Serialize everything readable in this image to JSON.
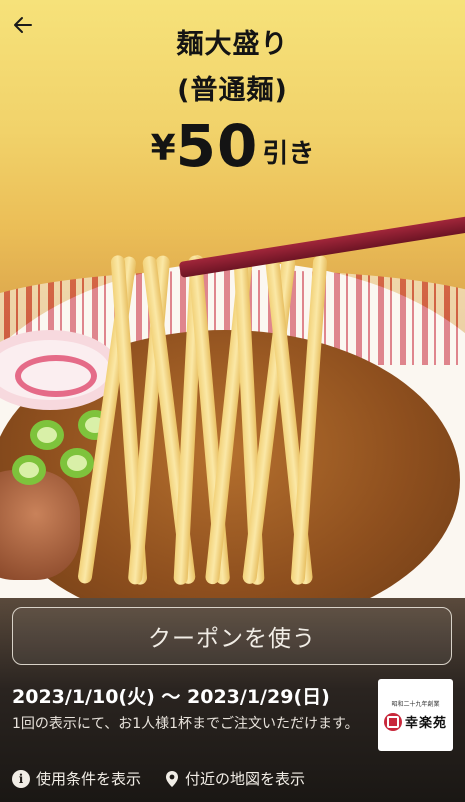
{
  "header": {
    "back_icon": "arrow-left-icon",
    "title_line1": "麺大盛り",
    "title_line2": "(普通麺)",
    "price_currency": "¥",
    "price_amount": "50",
    "price_suffix": "引き"
  },
  "coupon": {
    "use_button_label": "クーポンを使う",
    "period": "2023/1/10(火) 〜 2023/1/29(日)",
    "note": "1回の表示にて、お1人様1杯までご注文いただけます。"
  },
  "brand": {
    "logo_tagline": "昭和二十九年創業",
    "logo_name": "幸楽苑"
  },
  "links": {
    "terms_label": "使用条件を表示",
    "terms_icon": "info-icon",
    "map_label": "付近の地図を表示",
    "map_icon": "location-pin-icon"
  },
  "colors": {
    "accent_red": "#c8283b",
    "background_top": "#f6e27a",
    "panel": "#2a2420"
  }
}
